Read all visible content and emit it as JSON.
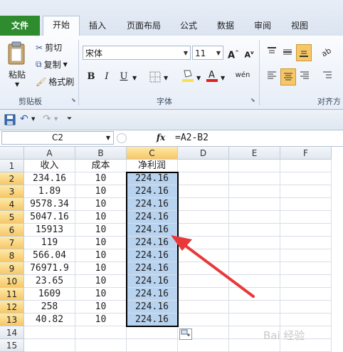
{
  "tabs": {
    "file": "文件",
    "home": "开始",
    "insert": "插入",
    "page_layout": "页面布局",
    "formulas": "公式",
    "data": "数据",
    "review": "审阅",
    "view": "视图"
  },
  "ribbon": {
    "paste": "粘贴",
    "cut": "剪切",
    "copy": "复制",
    "format_painter": "格式刷",
    "clipboard_group": "剪贴板",
    "font_name": "宋体",
    "font_size": "11",
    "font_group": "字体",
    "align_group": "对齐方",
    "bold": "B",
    "italic": "I",
    "underline": "U",
    "phonetic": "wén",
    "grow_font": "A",
    "shrink_font": "A"
  },
  "formula_bar": {
    "name_box": "C2",
    "fx": "fx",
    "formula": "=A2-B2"
  },
  "sheet": {
    "columns": [
      "A",
      "B",
      "C",
      "D",
      "E",
      "F"
    ],
    "rows": [
      "1",
      "2",
      "3",
      "4",
      "5",
      "6",
      "7",
      "8",
      "9",
      "10",
      "11",
      "12",
      "13",
      "14",
      "15"
    ],
    "headers": [
      "收入",
      "成本",
      "净利润"
    ],
    "data": [
      [
        "234.16",
        "10",
        "224.16"
      ],
      [
        "1.89",
        "10",
        "224.16"
      ],
      [
        "9578.34",
        "10",
        "224.16"
      ],
      [
        "5047.16",
        "10",
        "224.16"
      ],
      [
        "15913",
        "10",
        "224.16"
      ],
      [
        "119",
        "10",
        "224.16"
      ],
      [
        "566.04",
        "10",
        "224.16"
      ],
      [
        "76971.9",
        "10",
        "224.16"
      ],
      [
        "23.65",
        "10",
        "224.16"
      ],
      [
        "1609",
        "10",
        "224.16"
      ],
      [
        "258",
        "10",
        "224.16"
      ],
      [
        "40.82",
        "10",
        "224.16"
      ]
    ],
    "selected_cell": "C2",
    "selection_color": "#b8d3ef"
  },
  "annotation": {
    "arrow_color": "#e8383a"
  },
  "watermark": "Bai 经验",
  "colors": {
    "file_tab": "#2e8b2e",
    "highlight": "#f7c766",
    "font_color": "#e02020",
    "fill_color": "#f6e24a"
  }
}
